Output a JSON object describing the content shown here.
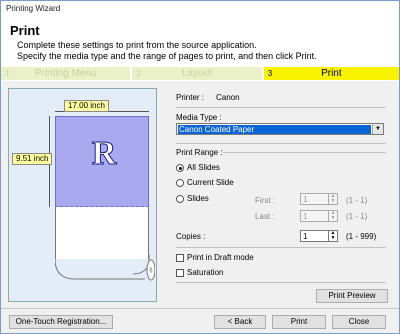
{
  "window": {
    "title": "Printing Wizard"
  },
  "header": {
    "title": "Print",
    "description_line1": "Complete these settings to print from the source application.",
    "description_line2": "Specify the media type and the range of pages to print, and then click Print."
  },
  "steps": [
    {
      "num": "1",
      "label": "Printing Menu",
      "state": "done"
    },
    {
      "num": "2",
      "label": "Layout",
      "state": "done"
    },
    {
      "num": "3",
      "label": "Print",
      "state": "current"
    }
  ],
  "preview": {
    "width_label": "17.00 inch",
    "height_label": "9.51 inch",
    "glyph": "R"
  },
  "printer": {
    "label": "Printer :",
    "value": "Canon"
  },
  "media": {
    "label": "Media Type :",
    "selected": "Canon Coated Paper"
  },
  "print_range": {
    "label": "Print Range :",
    "options": [
      {
        "label": "All Slides",
        "checked": true
      },
      {
        "label": "Current Slide",
        "checked": false
      },
      {
        "label": "Slides",
        "checked": false
      }
    ],
    "first_label": "First :",
    "first_value": "1",
    "first_range": "(1 - 1)",
    "last_label": "Last :",
    "last_value": "1",
    "last_range": "(1 - 1)"
  },
  "copies": {
    "label": "Copies :",
    "value": "1",
    "range": "(1 - 999)"
  },
  "options": {
    "draft_label": "Print in Draft mode",
    "draft_checked": false,
    "saturation_label": "Saturation",
    "saturation_checked": false
  },
  "buttons": {
    "print_preview": "Print Preview",
    "one_touch": "One-Touch Registration...",
    "back": "< Back",
    "print": "Print",
    "close": "Close"
  },
  "colors": {
    "current_step_bg": "#f9f200",
    "done_step_bg": "#eaf1c8",
    "paper_fill": "#a9a9f0",
    "selection": "#0a64d6"
  }
}
